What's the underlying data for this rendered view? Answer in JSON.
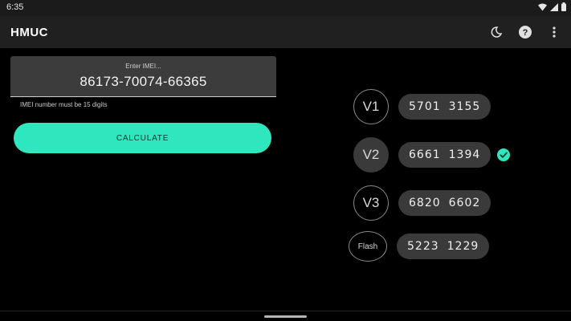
{
  "status_bar": {
    "time": "6:35"
  },
  "app_bar": {
    "title": "HMUC"
  },
  "imei": {
    "label": "Enter IMEI...",
    "value": "86173-70074-66365",
    "helper": "IMEI number must be 15 digits"
  },
  "calculate_button": {
    "label": "CALCULATE"
  },
  "codes": [
    {
      "version": "V1",
      "part1": "5701",
      "part2": "3155",
      "selected": false
    },
    {
      "version": "V2",
      "part1": "6661",
      "part2": "1394",
      "selected": true
    },
    {
      "version": "V3",
      "part1": "6820",
      "part2": "6602",
      "selected": false
    },
    {
      "version": "Flash",
      "part1": "5223",
      "part2": "1229",
      "selected": false
    }
  ],
  "colors": {
    "accent": "#2fe6be",
    "background": "#000000",
    "appbar": "#202020",
    "pill": "#3a3a3a"
  },
  "icons": [
    "wifi-icon",
    "signal-icon",
    "battery-icon",
    "dark-mode-icon",
    "help-icon",
    "more-icon",
    "check-circle-icon"
  ]
}
